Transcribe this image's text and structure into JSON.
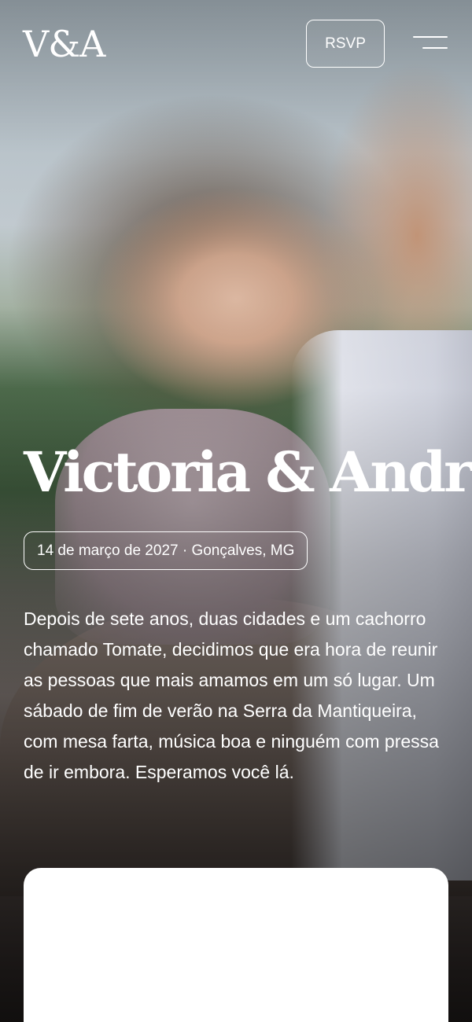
{
  "header": {
    "logo": "V&A",
    "rsvp_label": "RSVP"
  },
  "hero": {
    "title": "Victoria & André",
    "date_location": "14 de março de 2027 · Gonçalves, MG",
    "intro": "Depois de sete anos, duas cidades e um cachorro chamado Tomate, decidimos que era hora de reunir as pessoas que mais amamos em um só lugar. Um sábado de fim de verão na Serra da Mantiqueira, com mesa farta, música boa e ninguém com pressa de ir embora. Esperamos você lá."
  },
  "icons": {
    "menu": "hamburger-menu-icon"
  },
  "colors": {
    "text": "#ffffff",
    "card": "#ffffff"
  }
}
